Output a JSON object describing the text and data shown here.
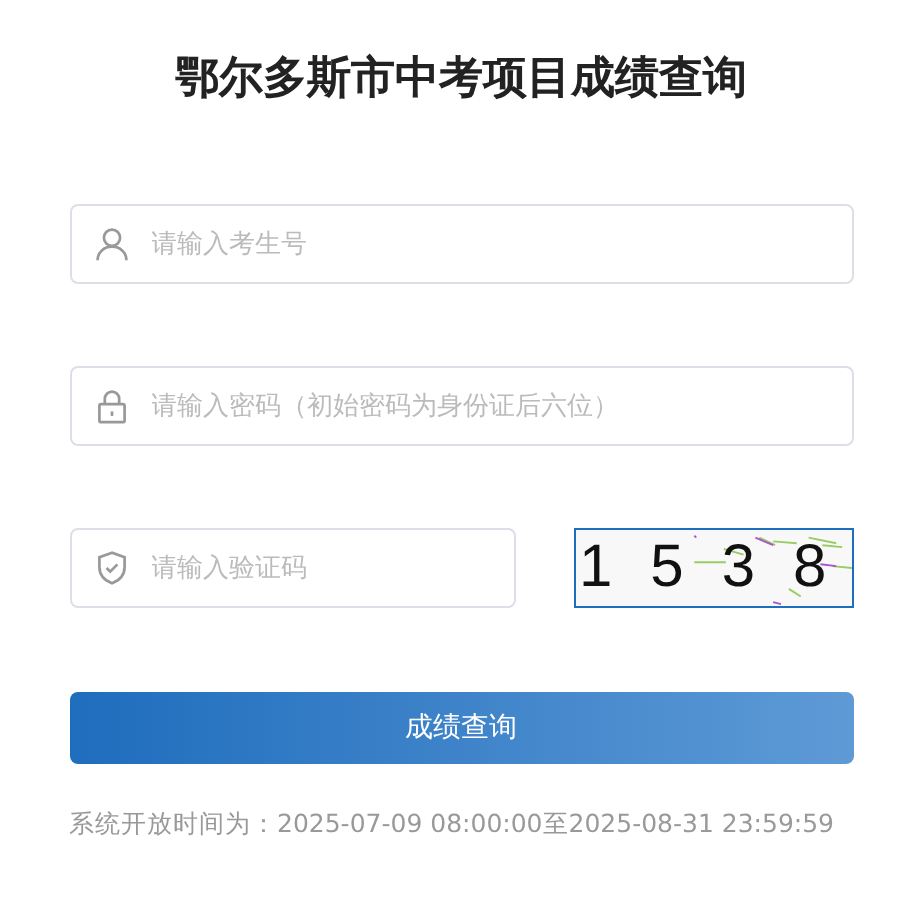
{
  "title": "鄂尔多斯市中考项目成绩查询",
  "fields": [
    {
      "kind": "user",
      "placeholder": "请输入考生号"
    },
    {
      "kind": "lock",
      "placeholder": "请输入密码（初始密码为身份证后六位）"
    },
    {
      "kind": "shield",
      "placeholder": "请输入验证码"
    }
  ],
  "captcha": {
    "text": "1538"
  },
  "submit_button": "成绩查询",
  "open_time": "系统开放时间为：2025-07-09 08:00:00至2025-08-31 23:59:59"
}
